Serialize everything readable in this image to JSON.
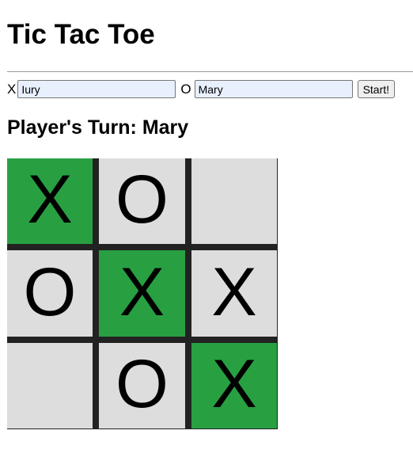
{
  "header": {
    "title": "Tic Tac Toe"
  },
  "players": {
    "x_label": "X",
    "x_value": "Iury",
    "o_label": "O",
    "o_value": "Mary",
    "start_label": "Start!"
  },
  "status": {
    "turn_text": "Player's Turn: Mary"
  },
  "board": {
    "cells": [
      {
        "mark": "X",
        "winning": true
      },
      {
        "mark": "O",
        "winning": false
      },
      {
        "mark": "",
        "winning": false
      },
      {
        "mark": "O",
        "winning": false
      },
      {
        "mark": "X",
        "winning": true
      },
      {
        "mark": "X",
        "winning": false
      },
      {
        "mark": "",
        "winning": false
      },
      {
        "mark": "O",
        "winning": false
      },
      {
        "mark": "X",
        "winning": true
      }
    ]
  },
  "colors": {
    "cell": "#dddddd",
    "winning_cell": "#28a042",
    "grid_lines": "#222222",
    "input_bg": "#e8f0fe"
  }
}
